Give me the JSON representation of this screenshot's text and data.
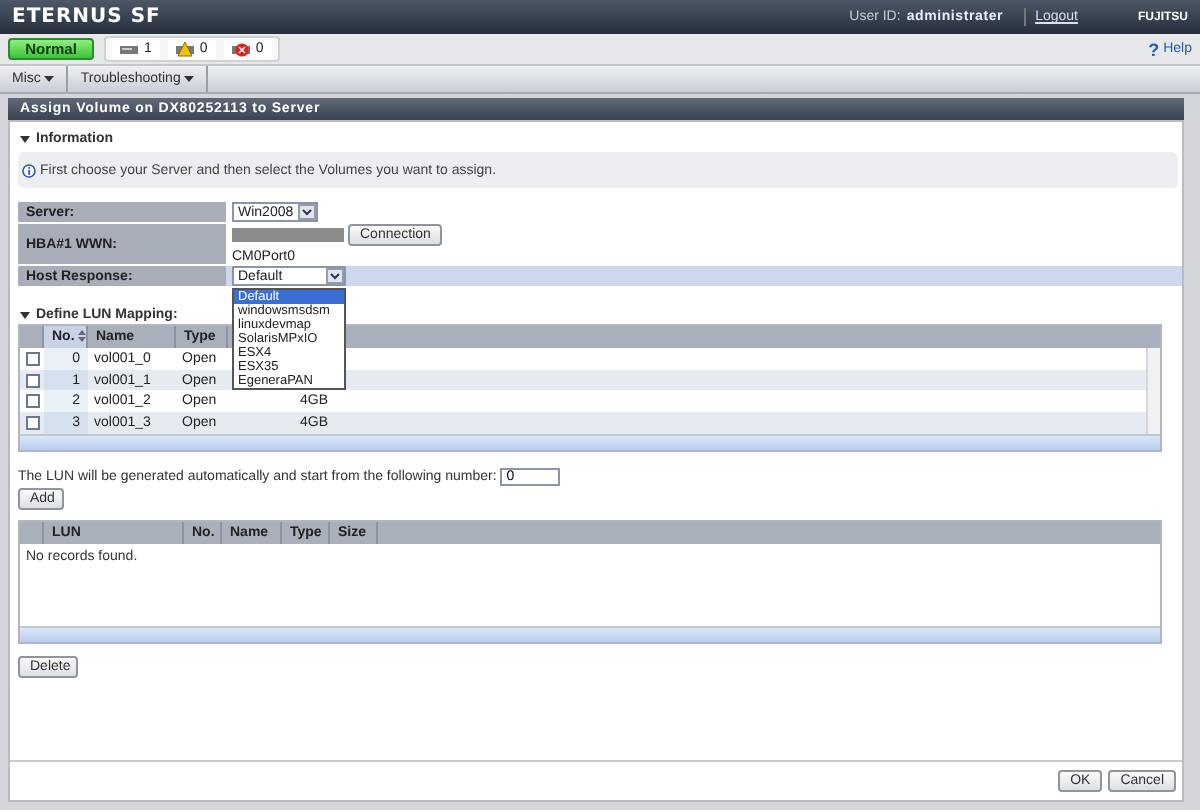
{
  "header": {
    "logo": "ETERNUS SF",
    "user_label": "User ID:",
    "user": "administrater",
    "logout": "Logout",
    "brand": "FUJITSU"
  },
  "status": {
    "state": "Normal",
    "counts": [
      {
        "kind": "device",
        "count": "1"
      },
      {
        "kind": "warning",
        "count": "0"
      },
      {
        "kind": "error",
        "count": "0"
      }
    ],
    "help_mark": "?",
    "help": "Help"
  },
  "menus": [
    {
      "label": "Misc"
    },
    {
      "label": "Troubleshooting"
    }
  ],
  "page_title": "Assign Volume on DX80252113 to Server",
  "information": {
    "heading": "Information",
    "expanded": true,
    "message": "First choose your Server and then select the Volumes you want to assign."
  },
  "form": {
    "server": {
      "label": "Server:",
      "value": "Win2008"
    },
    "wwn": {
      "label": "HBA#1 WWN:",
      "button": "Connection",
      "port": "CM0Port0"
    },
    "host_response": {
      "label": "Host Response:",
      "value": "Default",
      "open": true,
      "options": [
        {
          "label": "Default",
          "selected": true
        },
        {
          "label": "windowsmsdsm",
          "selected": false
        },
        {
          "label": "linuxdevmap",
          "selected": false
        },
        {
          "label": "SolarisMPxIO",
          "selected": false
        },
        {
          "label": "ESX4",
          "selected": false
        },
        {
          "label": "ESX35",
          "selected": false
        },
        {
          "label": "EgeneraPAN",
          "selected": false
        }
      ]
    }
  },
  "mapping": {
    "heading": "Define LUN Mapping:",
    "expanded": true,
    "columns": [
      "No.",
      "Name",
      "Type"
    ],
    "rows": [
      {
        "checked": false,
        "no": "0",
        "name": "vol001_0",
        "type": "Open"
      },
      {
        "checked": false,
        "no": "1",
        "name": "vol001_1",
        "type": "Open"
      },
      {
        "checked": false,
        "no": "2",
        "name": "vol001_2",
        "type": "Open",
        "size": "4GB"
      },
      {
        "checked": false,
        "no": "3",
        "name": "vol001_3",
        "type": "Open",
        "size": "4GB"
      }
    ]
  },
  "lun_start": {
    "label": "The LUN will be generated automatically and start from the following number:",
    "value": "0"
  },
  "add_button": "Add",
  "assigned": {
    "columns": [
      "LUN",
      "No.",
      "Name",
      "Type",
      "Size"
    ],
    "empty_text": "No records found."
  },
  "delete_button": "Delete",
  "footer_buttons": [
    "OK",
    "Cancel"
  ]
}
